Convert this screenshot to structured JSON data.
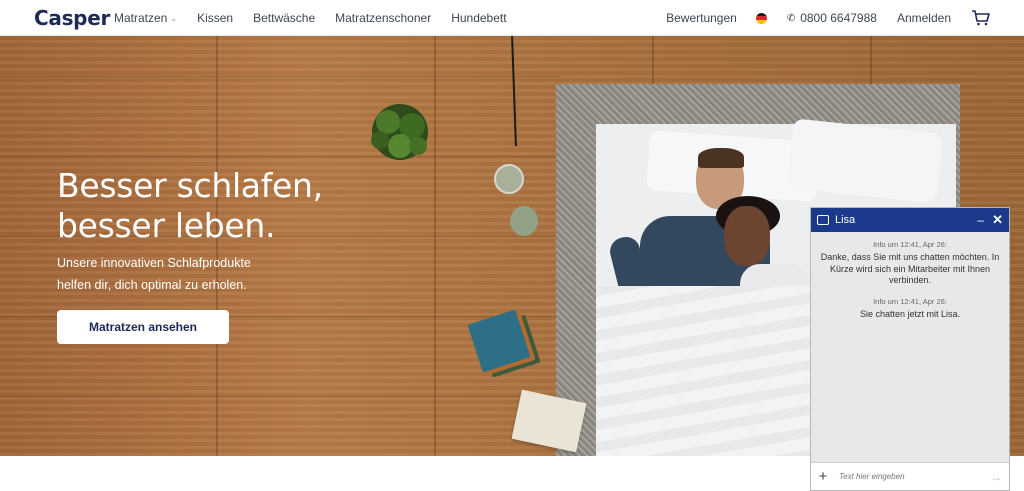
{
  "header": {
    "logo": "Casper",
    "nav": [
      {
        "label": "Matratzen",
        "has_dropdown": true
      },
      {
        "label": "Kissen"
      },
      {
        "label": "Bettwäsche"
      },
      {
        "label": "Matratzenschoner"
      },
      {
        "label": "Hundebett"
      }
    ],
    "reviews": "Bewertungen",
    "phone": "0800 6647988",
    "login": "Anmelden",
    "icons": {
      "flag": "germany-flag-icon",
      "phone": "phone-icon",
      "cart": "cart-icon"
    },
    "colors": {
      "brand": "#1d2a57"
    }
  },
  "hero": {
    "title_line1": "Besser schlafen,",
    "title_line2": "besser leben.",
    "subtitle_line1": "Unsere innovativen Schlafprodukte",
    "subtitle_line2": "helfen dir, dich optimal zu erholen.",
    "cta": "Matratzen ansehen"
  },
  "chat": {
    "agent": "Lisa",
    "header_color": "#1b3a8c",
    "messages": [
      {
        "meta": "Info um 12:41, Apr 26:",
        "text": "Danke, dass Sie mit uns chatten möchten. In Kürze wird sich ein Mitarbeiter mit Ihnen verbinden."
      },
      {
        "meta": "Info um 12:41, Apr 26:",
        "text": "Sie chatten jetzt mit Lisa."
      }
    ],
    "input_placeholder": "Text hier eingeben"
  }
}
